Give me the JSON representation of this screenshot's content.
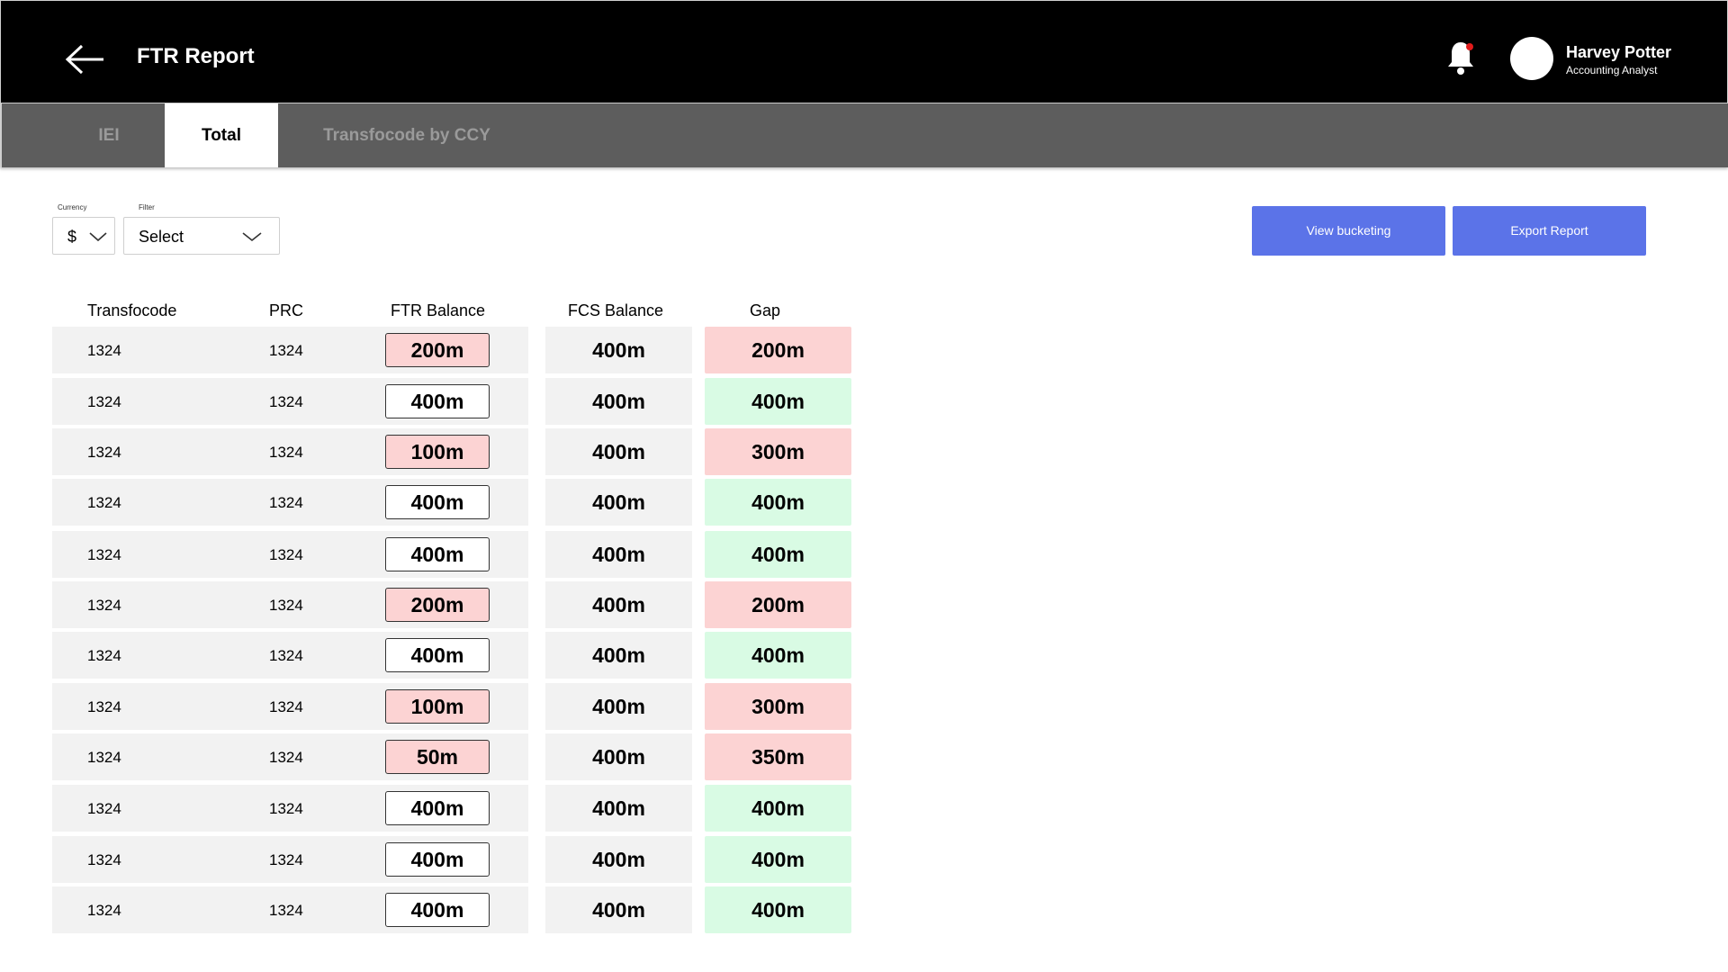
{
  "header": {
    "title": "FTR Report",
    "user_name": "Harvey Potter",
    "user_role": "Accounting Analyst"
  },
  "tabs": [
    {
      "label": "IEI",
      "active": false
    },
    {
      "label": "Total",
      "active": true
    },
    {
      "label": "Transfocode by CCY",
      "active": false
    }
  ],
  "filters": {
    "currency_label": "Currency",
    "currency_value": "$",
    "filter_label": "Filter",
    "filter_value": "Select"
  },
  "actions": {
    "view_bucketing": "View bucketing",
    "export_report": "Export Report"
  },
  "table": {
    "columns": [
      "Transfocode",
      "PRC",
      "FTR Balance",
      "FCS Balance",
      "Gap"
    ],
    "rows": [
      {
        "transfocode": "1324",
        "prc": "1324",
        "ftr": "200m",
        "fcs": "400m",
        "gap": "200m",
        "status": "negative"
      },
      {
        "transfocode": "1324",
        "prc": "1324",
        "ftr": "400m",
        "fcs": "400m",
        "gap": "400m",
        "status": "positive"
      },
      {
        "transfocode": "1324",
        "prc": "1324",
        "ftr": "100m",
        "fcs": "400m",
        "gap": "300m",
        "status": "negative"
      },
      {
        "transfocode": "1324",
        "prc": "1324",
        "ftr": "400m",
        "fcs": "400m",
        "gap": "400m",
        "status": "positive"
      },
      {
        "transfocode": "1324",
        "prc": "1324",
        "ftr": "400m",
        "fcs": "400m",
        "gap": "400m",
        "status": "positive"
      },
      {
        "transfocode": "1324",
        "prc": "1324",
        "ftr": "200m",
        "fcs": "400m",
        "gap": "200m",
        "status": "negative"
      },
      {
        "transfocode": "1324",
        "prc": "1324",
        "ftr": "400m",
        "fcs": "400m",
        "gap": "400m",
        "status": "positive"
      },
      {
        "transfocode": "1324",
        "prc": "1324",
        "ftr": "100m",
        "fcs": "400m",
        "gap": "300m",
        "status": "negative"
      },
      {
        "transfocode": "1324",
        "prc": "1324",
        "ftr": "50m",
        "fcs": "400m",
        "gap": "350m",
        "status": "negative"
      },
      {
        "transfocode": "1324",
        "prc": "1324",
        "ftr": "400m",
        "fcs": "400m",
        "gap": "400m",
        "status": "positive"
      },
      {
        "transfocode": "1324",
        "prc": "1324",
        "ftr": "400m",
        "fcs": "400m",
        "gap": "400m",
        "status": "positive"
      },
      {
        "transfocode": "1324",
        "prc": "1324",
        "ftr": "400m",
        "fcs": "400m",
        "gap": "400m",
        "status": "positive"
      }
    ]
  },
  "colors": {
    "accent": "#5b73e8",
    "negative_bg": "#fcd3d3",
    "positive_bg": "#d9fbe4",
    "header_bg": "#000000",
    "tabbar_bg": "#5d5d5d"
  },
  "icons": {
    "back": "arrow-left-icon",
    "notification": "bell-icon",
    "dropdown": "chevron-down-icon"
  }
}
